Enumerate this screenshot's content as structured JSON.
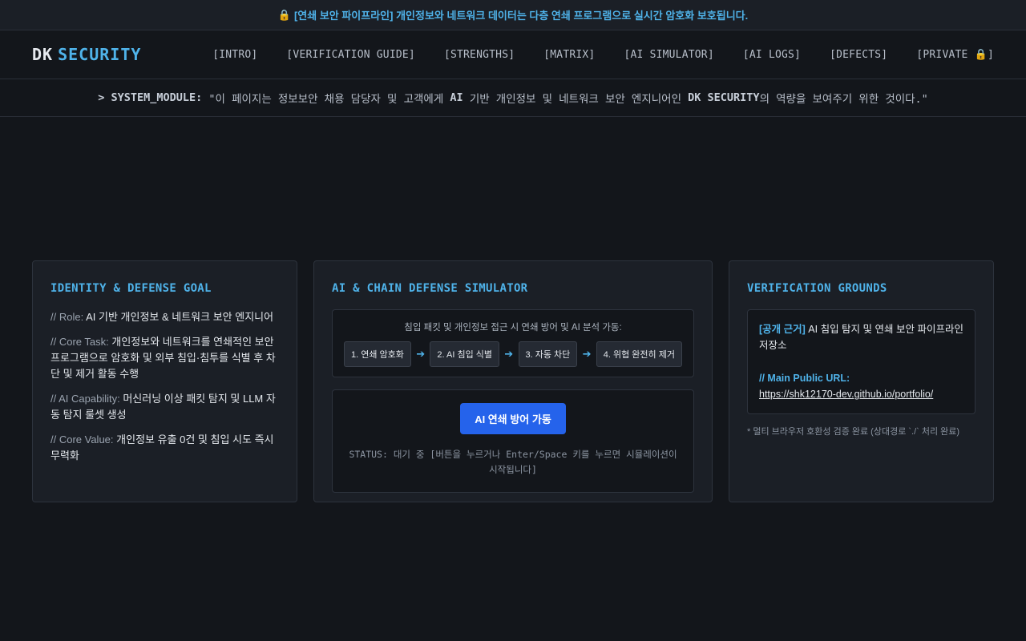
{
  "banner": {
    "icon": "lock-icon",
    "text": "[연쇄 보안 파이프라인] 개인정보와 네트워크 데이터는 다층 연쇄 프로그램으로 실시간 암호화 보호됩니다."
  },
  "header": {
    "logo_dk": "DK",
    "logo_security": "SECURITY",
    "nav": [
      "[INTRO]",
      "[VERIFICATION GUIDE]",
      "[STRENGTHS]",
      "[MATRIX]",
      "[AI SIMULATOR]",
      "[AI LOGS]",
      "[DEFECTS]",
      "[PRIVATE 🔒]"
    ]
  },
  "system_module": {
    "prefix": "> SYSTEM_MODULE:",
    "part1": "\"이 페이지는 정보보안 채용 담당자 및 고객에게",
    "bold1": "AI",
    "part2": "기반 개인정보 및 네트워크 보안 엔지니어인",
    "bold2": "DK SECURITY",
    "part3": "의 역량을 보여주기 위한 것이다.\""
  },
  "identity": {
    "title": "IDENTITY & DEFENSE GOAL",
    "items": [
      {
        "key": "// Role:",
        "value": "AI 기반 개인정보 & 네트워크 보안 엔지니어"
      },
      {
        "key": "// Core Task:",
        "value": "개인정보와 네트워크를 연쇄적인 보안프로그램으로 암호화 및 외부 침입·침투를 식별 후 차단 및 제거 활동 수행"
      },
      {
        "key": "// AI Capability:",
        "value": "머신러닝 이상 패킷 탐지 및 LLM 자동 탐지 룰셋 생성"
      },
      {
        "key": "// Core Value:",
        "value": "개인정보 유출 0건 및 침입 시도 즉시 무력화"
      }
    ]
  },
  "simulator": {
    "title": "AI & CHAIN DEFENSE SIMULATOR",
    "caption": "침입 패킷 및 개인정보 접근 시 연쇄 방어 및 AI 분석 가동:",
    "steps": [
      "1. 연쇄 암호화",
      "2. AI 침입 식별",
      "3. 자동 차단",
      "4. 위협 완전히 제거"
    ],
    "button": "AI 연쇄 방어 가동",
    "status": "STATUS: 대기 중 [버튼을 누르거나 Enter/Space 키를 누르면 시뮬레이션이 시작됩니다]"
  },
  "grounds": {
    "title": "VERIFICATION GROUNDS",
    "tag": "[공개 근거]",
    "repo_text": "AI 침입 탐지 및 연쇄 보안 파이프라인 저장소",
    "url_label": "// Main Public URL:",
    "url": "https://shk12170-dev.github.io/portfolio/",
    "note": "* 멀티 브라우저 호환성 검증 완료 (상대경로 `./` 처리 완료)"
  },
  "colors": {
    "accent": "#4fb3ea",
    "button": "#2563eb",
    "background": "#13161b",
    "card": "#1b1f26"
  }
}
